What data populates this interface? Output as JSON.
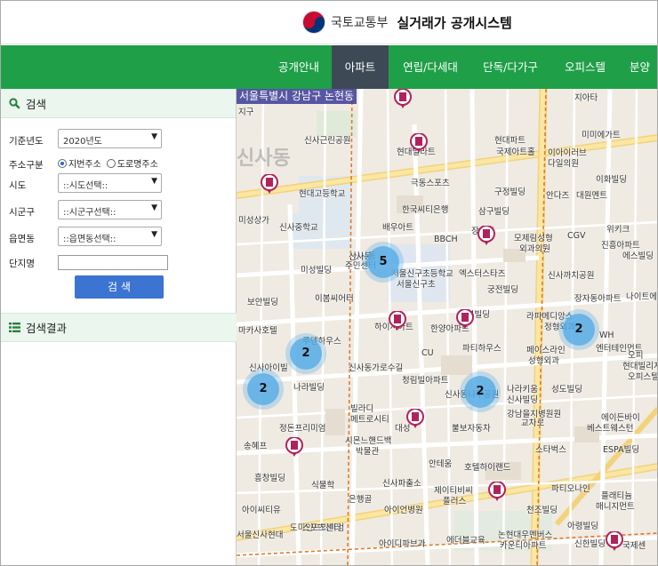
{
  "header": {
    "ministry": "국토교통부",
    "system_name": "실거래가 공개시스템"
  },
  "nav": {
    "items": [
      {
        "label": "공개안내",
        "active": false
      },
      {
        "label": "아파트",
        "active": true
      },
      {
        "label": "연립/다세대",
        "active": false
      },
      {
        "label": "단독/다가구",
        "active": false
      },
      {
        "label": "오피스텔",
        "active": false
      },
      {
        "label": "분양",
        "active": false
      }
    ]
  },
  "sidebar": {
    "search_title": "검색",
    "search_icon": "magnifier-icon",
    "fields": {
      "year": {
        "label": "기준년도",
        "value": "2020년도"
      },
      "address_type": {
        "label": "주소구분",
        "options": [
          "지번주소",
          "도로명주소"
        ],
        "selected": "지번주소"
      },
      "city": {
        "label": "시도",
        "value": "::시도선택::"
      },
      "district": {
        "label": "시군구",
        "value": "::시군구선택::"
      },
      "town": {
        "label": "읍면동",
        "value": "::읍면동선택::"
      },
      "complex": {
        "label": "단지명",
        "value": ""
      }
    },
    "search_button": "검 색",
    "results_title": "검색결과",
    "results_icon": "list-icon"
  },
  "map": {
    "address_label": "서울특별시 강남구 논현동",
    "district_watermark": "신사동",
    "clusters": [
      {
        "count": "5"
      },
      {
        "count": "2"
      },
      {
        "count": "2"
      },
      {
        "count": "2"
      },
      {
        "count": "2"
      }
    ],
    "labels": [
      "지구",
      "신사근린공원",
      "현대파트",
      "국제아트홀",
      "현대빌라트",
      "지아타",
      "미미에가트",
      "이아이러브",
      "다일의원",
      "이화빌딩",
      "극동스포츠",
      "현대고등학교",
      "구정빌딩",
      "안다즈",
      "대원멘트",
      "위키크",
      "신사중학교",
      "한국씨티은행",
      "삼구빌딩",
      "미성상가",
      "배우아트",
      "모제림성형",
      "외과의원",
      "CGV",
      "진흥아파트",
      "BBCH",
      "장천흥",
      "신사동",
      "주민센터",
      "미성빌딩",
      "신사까치공원",
      "에스빌딩",
      "엑스터스타즈",
      "궁전빌딩",
      "보안빌딩",
      "이봄씨어터",
      "서울신구초등학교",
      "장자동아파트",
      "나이트에셋",
      "일봉빌딩",
      "라파메디앙스",
      "정형외과",
      "WH",
      "엔터테인먼트",
      "마카사호텔",
      "루덴하우스",
      "한양아파트",
      "파티하우스",
      "페이스라인",
      "성형외과",
      "현대빌리지",
      "오피스텔",
      "신사아이빌",
      "CU",
      "청림빌아파트",
      "신사동가로수길",
      "나라빌딩",
      "나라키움",
      "신사빌딩",
      "성도빌딩",
      "신사동나무공원",
      "강남을지병원원",
      "교차로",
      "에이든바이",
      "베스트웨스턴",
      "정돈프리미엄",
      "빌라디",
      "메트로시티",
      "불보자동차",
      "송혜프",
      "시몬느핸드백",
      "박물관",
      "스타벅스",
      "ESPA빌딩",
      "흥창빌딩",
      "안테움",
      "호텔하이랜드",
      "식물학",
      "은행골",
      "신사파출소",
      "제이티비씨",
      "플러스",
      "파티오나인",
      "플래티늄",
      "매니지먼트",
      "아이씨티유",
      "아이언병원",
      "천조빌딩",
      "도미인프리미엄",
      "서울신사현대",
      "아이디파브과",
      "에더블교육",
      "논현대우멘버스",
      "아령빌딩",
      "신한빌딩",
      "카운티아파트",
      "국제센",
      "서울신구초",
      "오피",
      "하이시아트",
      "대성",
      "신사동",
      "스포츠센터"
    ]
  }
}
